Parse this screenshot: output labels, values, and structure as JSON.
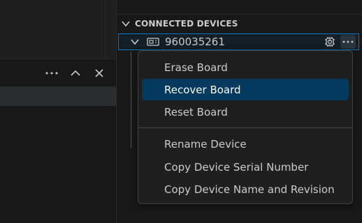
{
  "panel": {
    "actions": [
      "more-actions-icon",
      "chevron-up-icon",
      "close-icon"
    ]
  },
  "sidebar": {
    "section_title": "CONNECTED DEVICES",
    "device": {
      "label": "960035261",
      "icon": "board-icon",
      "actions": [
        "device-chip-icon",
        "more-actions-icon"
      ]
    }
  },
  "context_menu": {
    "groups": [
      [
        "Erase Board",
        "Recover Board",
        "Reset Board"
      ],
      [
        "Rename Device",
        "Copy Device Serial Number",
        "Copy Device Name and Revision"
      ]
    ],
    "selected": "Recover Board"
  },
  "colors": {
    "focus_border": "#0078d4",
    "selection_bg": "#04395e",
    "menu_bg": "#1f1f1f"
  }
}
